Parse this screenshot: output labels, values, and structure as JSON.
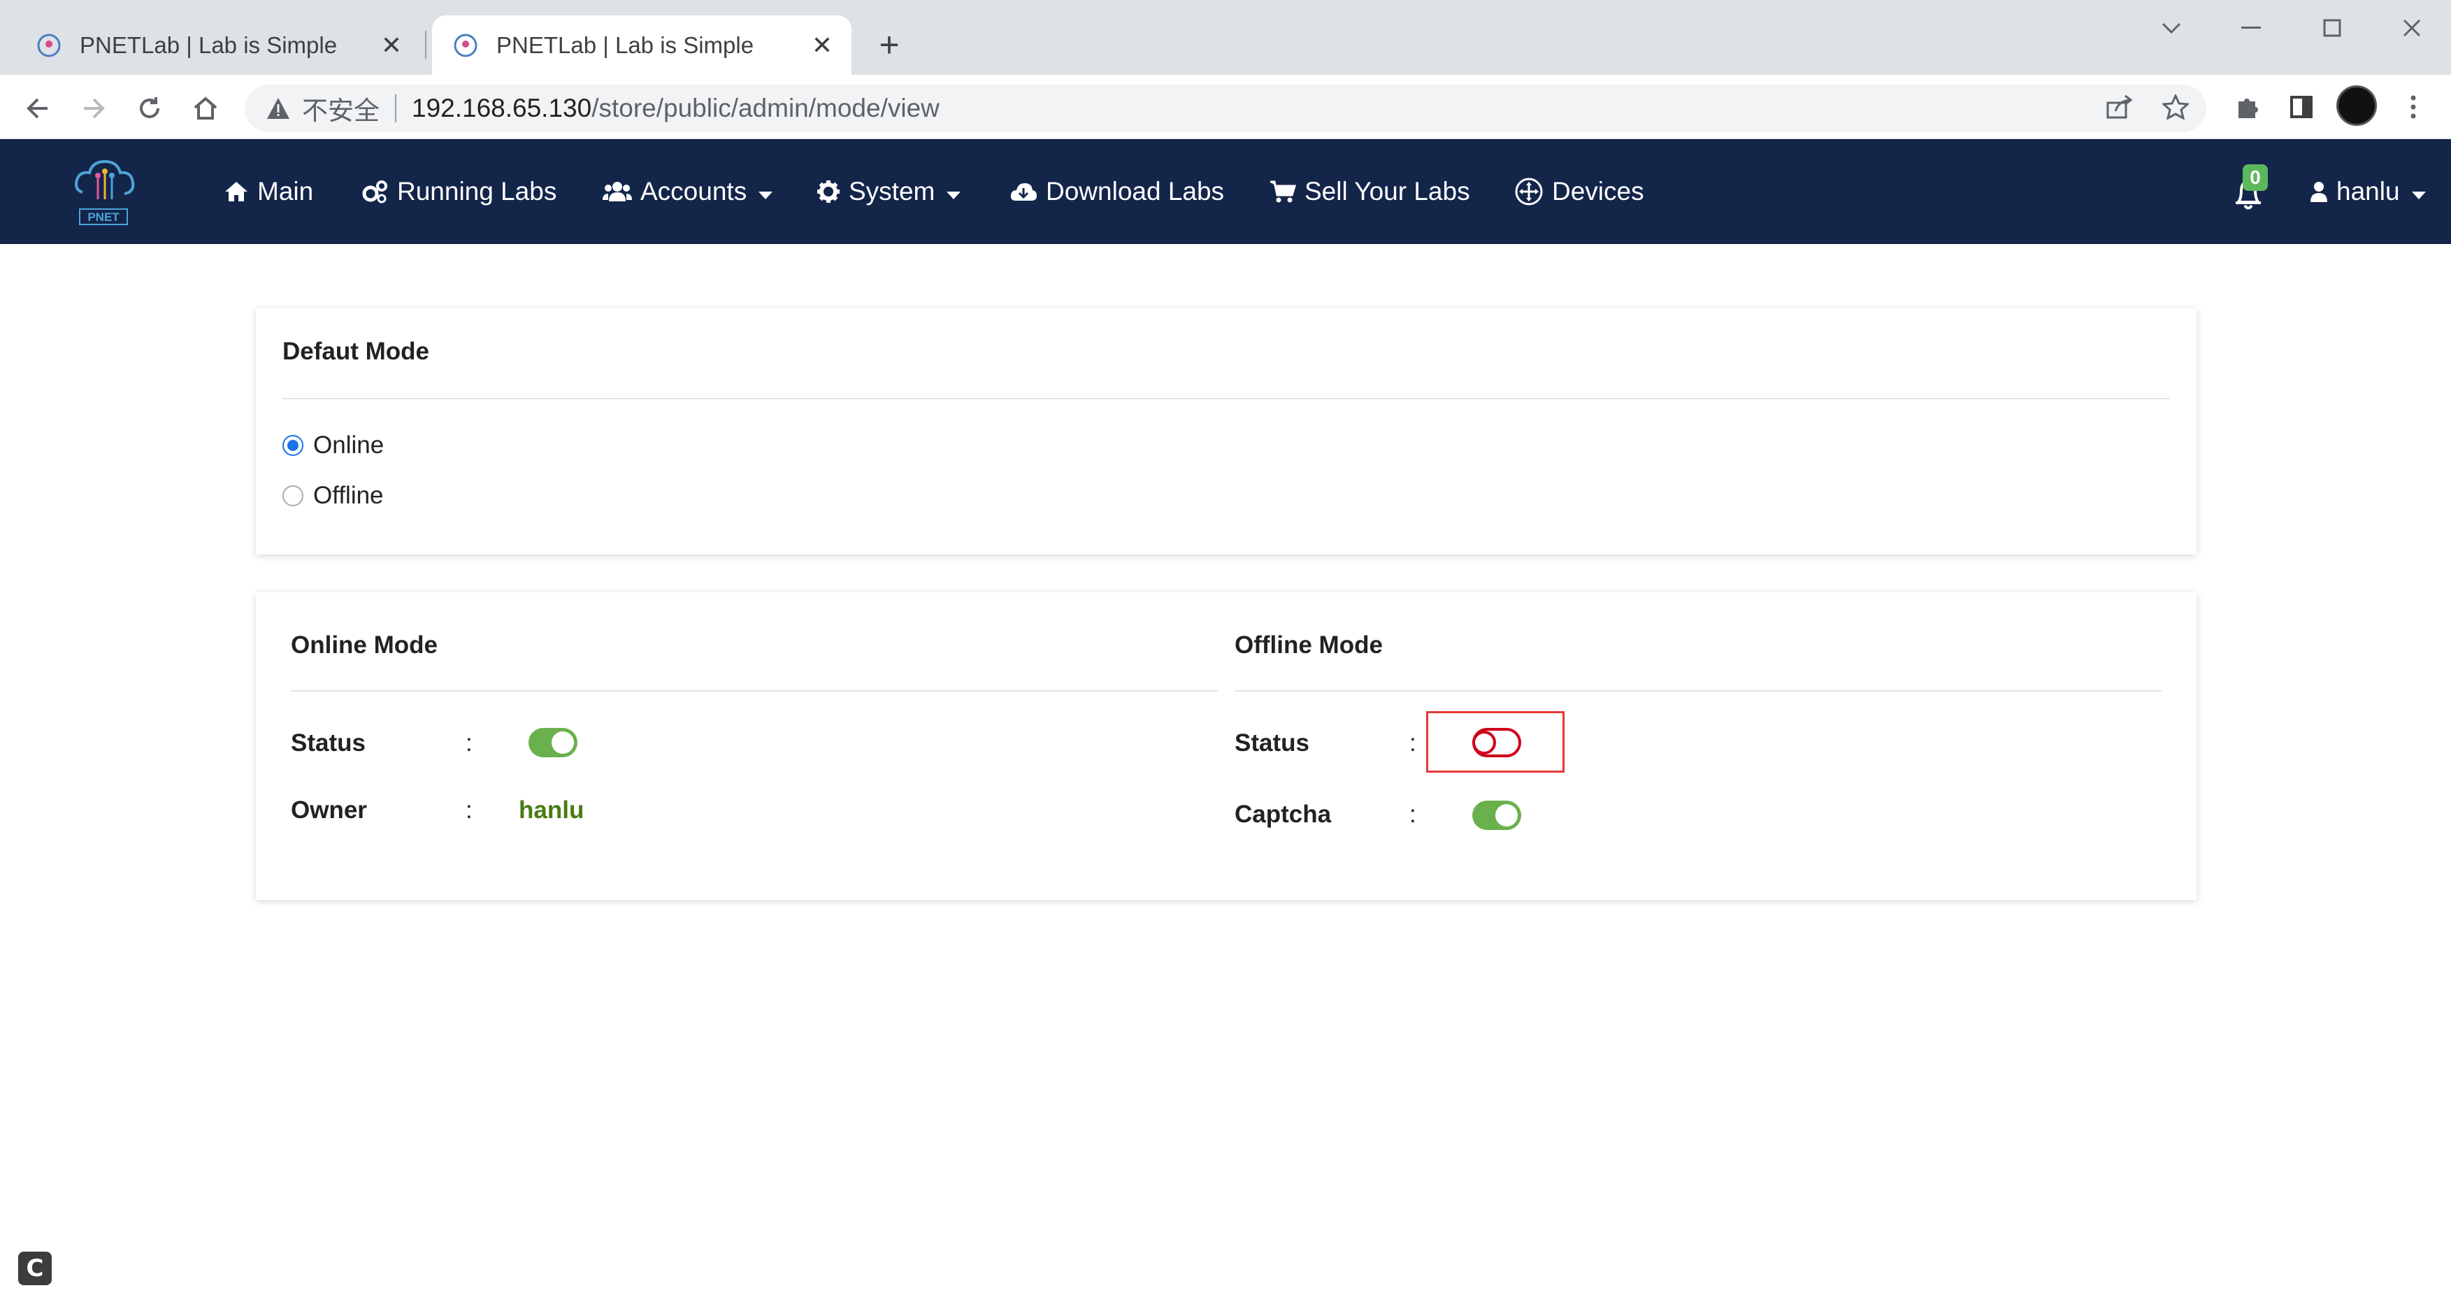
{
  "browser": {
    "tabs": [
      {
        "title": "PNETLab | Lab is Simple",
        "active": false
      },
      {
        "title": "PNETLab | Lab is Simple",
        "active": true
      }
    ],
    "new_tab_label": "+",
    "security_label": "不安全",
    "url_host": "192.168.65.130",
    "url_path": "/store/public/admin/mode/view"
  },
  "navbar": {
    "logo_text": "PNET",
    "items": [
      {
        "label": "Main",
        "icon": "home-icon"
      },
      {
        "label": "Running Labs",
        "icon": "cogs-icon"
      },
      {
        "label": "Accounts",
        "icon": "users-icon",
        "dropdown": true
      },
      {
        "label": "System",
        "icon": "gear-icon",
        "dropdown": true
      },
      {
        "label": "Download Labs",
        "icon": "cloud-download-icon"
      },
      {
        "label": "Sell Your Labs",
        "icon": "cart-icon"
      },
      {
        "label": "Devices",
        "icon": "arrows-icon"
      }
    ],
    "notification_count": "0",
    "user": "hanlu"
  },
  "default_mode": {
    "title": "Defaut Mode",
    "options": [
      {
        "label": "Online",
        "checked": true
      },
      {
        "label": "Offline",
        "checked": false
      }
    ]
  },
  "online_mode": {
    "title": "Online Mode",
    "status_label": "Status",
    "status_on": true,
    "owner_label": "Owner",
    "owner_value": "hanlu",
    "separator": ":"
  },
  "offline_mode": {
    "title": "Offline Mode",
    "status_label": "Status",
    "status_on": false,
    "captcha_label": "Captcha",
    "captcha_on": true,
    "separator": ":"
  },
  "colors": {
    "navbar_bg": "#14254a",
    "toggle_on": "#6ab04c",
    "toggle_off_border": "#d0021b",
    "owner_text": "#4a7c12",
    "radio_accent": "#1a73e8"
  },
  "corner_icon_letter": "C"
}
